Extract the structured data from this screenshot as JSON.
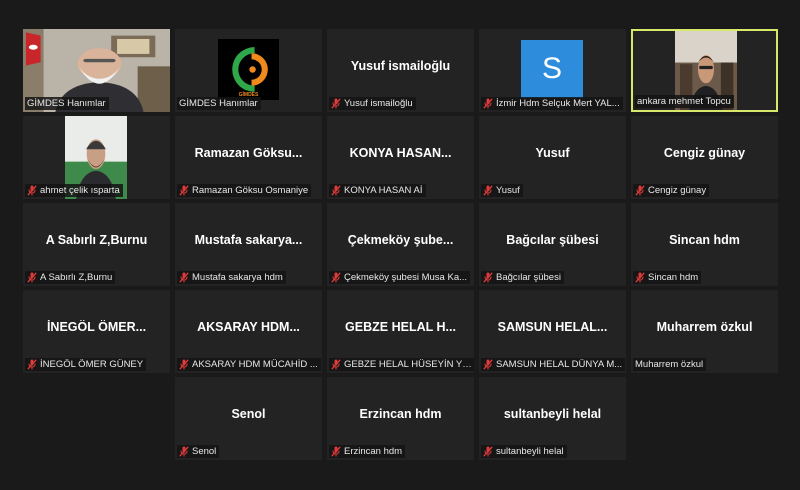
{
  "colors": {
    "active_border": "#d8e86a",
    "mute": "#e03a3a",
    "tile_bg": "#232323",
    "avatar_blue": "#2d8cdb"
  },
  "tiles": [
    {
      "center": "",
      "label": "GİMDES Hanımlar",
      "muted": false,
      "media": "video-elderly-man"
    },
    {
      "center": "",
      "label": "GİMDES Hanımlar",
      "muted": false,
      "media": "gimdes-logo",
      "logo_text": "GİMDES"
    },
    {
      "center": "Yusuf ismailoğlu",
      "label": "Yusuf ismailoğlu",
      "muted": true,
      "media": ""
    },
    {
      "center": "",
      "label": "İzmir Hdm Selçuk Mert YAL...",
      "muted": true,
      "media": "avatar",
      "avatar_letter": "S"
    },
    {
      "center": "",
      "label": "ankara mehmet Topcu",
      "muted": false,
      "media": "video-young-man",
      "active": true
    },
    {
      "center": "",
      "label": "ahmet çelik ısparta",
      "muted": true,
      "media": "video-man-cap"
    },
    {
      "center": "Ramazan Göksu...",
      "label": "Ramazan Göksu Osmaniye",
      "muted": true,
      "media": ""
    },
    {
      "center": "KONYA HASAN...",
      "label": "KONYA HASAN Aİ",
      "muted": true,
      "media": ""
    },
    {
      "center": "Yusuf",
      "label": "Yusuf",
      "muted": true,
      "media": ""
    },
    {
      "center": "Cengiz günay",
      "label": "Cengiz günay",
      "muted": true,
      "media": ""
    },
    {
      "center": "A Sabırlı Z,Burnu",
      "label": "A Sabırlı Z,Burnu",
      "muted": true,
      "media": ""
    },
    {
      "center": "Mustafa sakarya...",
      "label": "Mustafa sakarya hdm",
      "muted": true,
      "media": ""
    },
    {
      "center": "Çekmeköy şube...",
      "label": "Çekmeköy şubesi Musa Ka...",
      "muted": true,
      "media": ""
    },
    {
      "center": "Bağcılar şübesi",
      "label": "Bağcılar şübesi",
      "muted": true,
      "media": ""
    },
    {
      "center": "Sincan hdm",
      "label": "Sincan hdm",
      "muted": true,
      "media": ""
    },
    {
      "center": "İNEGÖL ÖMER...",
      "label": "İNEGÖL ÖMER GÜNEY",
      "muted": true,
      "media": ""
    },
    {
      "center": "AKSARAY HDM...",
      "label": "AKSARAY HDM MÜCAHİD ...",
      "muted": true,
      "media": ""
    },
    {
      "center": "GEBZE HELAL H...",
      "label": "GEBZE HELAL HÜSEYİN YIL...",
      "muted": true,
      "media": ""
    },
    {
      "center": "SAMSUN HELAL...",
      "label": "SAMSUN HELAL DÜNYA M...",
      "muted": true,
      "media": ""
    },
    {
      "center": "Muharrem özkul",
      "label": "Muharrem özkul",
      "muted": false,
      "media": ""
    },
    {
      "center": "Senol",
      "label": "Senol",
      "muted": true,
      "media": ""
    },
    {
      "center": "Erzincan hdm",
      "label": "Erzincan hdm",
      "muted": true,
      "media": ""
    },
    {
      "center": "sultanbeyli helal",
      "label": "sultanbeyli helal",
      "muted": true,
      "media": ""
    }
  ]
}
